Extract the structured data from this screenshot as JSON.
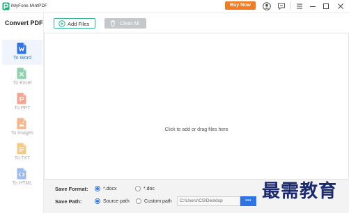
{
  "window": {
    "title": "iMyFone MintPDF",
    "buy_now": "Buy Now"
  },
  "titlebar_icons": [
    "app-logo-icon",
    "account-icon",
    "feedback-icon",
    "menu-icon",
    "minimize-icon",
    "maximize-icon",
    "close-icon"
  ],
  "sidebar": {
    "heading": "Convert PDF",
    "items": [
      {
        "label": "To Word",
        "icon": "word-file-icon",
        "color": "#2f74e6",
        "active": true
      },
      {
        "label": "To Excel",
        "icon": "excel-file-icon",
        "color": "#8ed1ab",
        "active": false
      },
      {
        "label": "To PPT",
        "icon": "ppt-file-icon",
        "color": "#f4a58f",
        "active": false
      },
      {
        "label": "To Images",
        "icon": "image-file-icon",
        "color": "#f6b58a",
        "active": false
      },
      {
        "label": "To TXT",
        "icon": "txt-file-icon",
        "color": "#f3cb86",
        "active": false
      },
      {
        "label": "To HTML",
        "icon": "html-file-icon",
        "color": "#9ebcf1",
        "active": false
      }
    ]
  },
  "toolbar": {
    "add_files": "Add Files",
    "add_files_icon": "plus-circle-icon",
    "clear_all": "Clear All",
    "clear_all_icon": "trash-icon",
    "clear_all_enabled": false
  },
  "dropzone": {
    "hint": "Click to add or drag files here"
  },
  "save_format": {
    "label": "Save Format:",
    "options": [
      {
        "label": "*.docx",
        "selected": true
      },
      {
        "label": "*.doc",
        "selected": false
      }
    ]
  },
  "save_path": {
    "label": "Save Path:",
    "options": [
      {
        "label": "Source path",
        "selected": true
      },
      {
        "label": "Custom path",
        "selected": false
      }
    ],
    "path": "C:\\Users\\CS\\Desktop",
    "browse": "•••"
  },
  "watermark": {
    "text": "最需教育"
  },
  "colors": {
    "accent": "#2f74e6",
    "buy_now": "#f47b20",
    "add_files_border": "#2fb397",
    "disabled": "#c5c7cb",
    "watermark": "#1b2a70"
  }
}
